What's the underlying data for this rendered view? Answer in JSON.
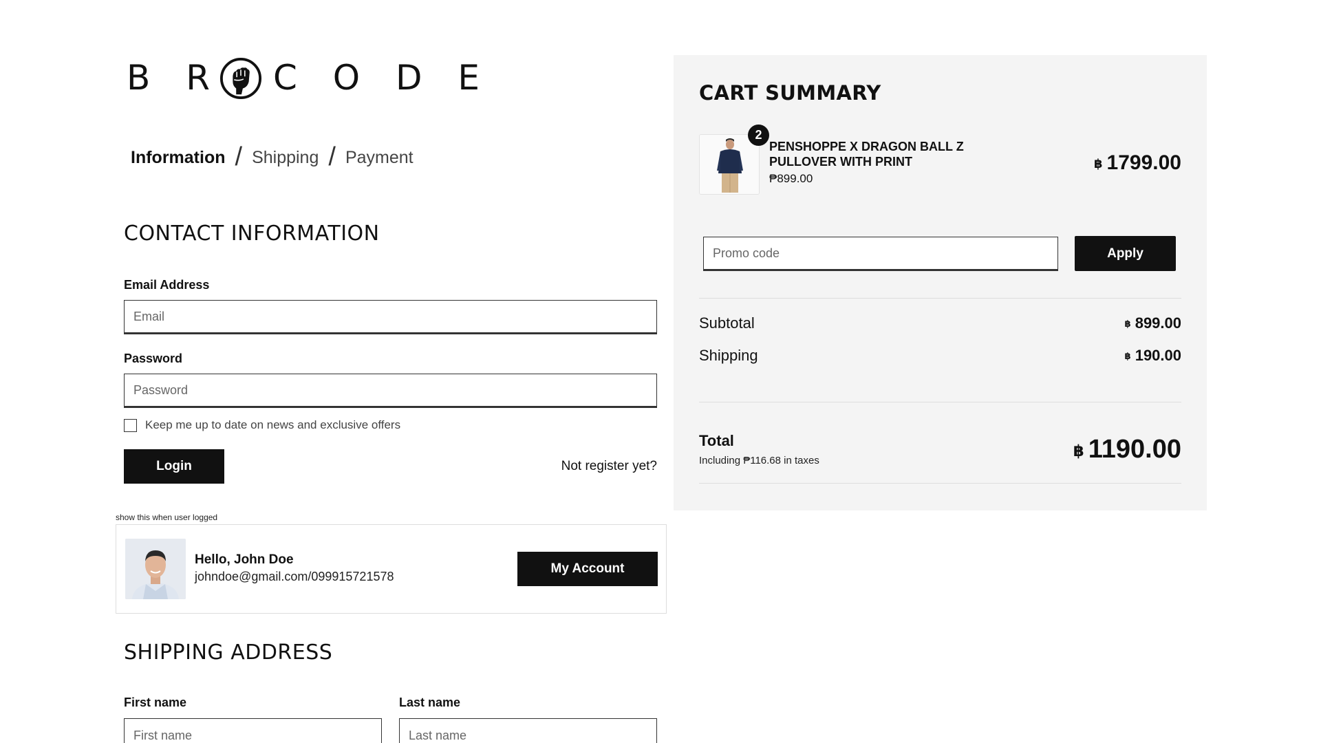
{
  "brand": {
    "prefix": "B R",
    "suffix": "C O D E"
  },
  "steps": [
    {
      "label": "Information",
      "active": true
    },
    {
      "label": "Shipping",
      "active": false
    },
    {
      "label": "Payment",
      "active": false
    }
  ],
  "contact": {
    "title": "CONTACT INFORMATION",
    "email_label": "Email Address",
    "email_placeholder": "Email",
    "password_label": "Password",
    "password_placeholder": "Password",
    "newsletter_label": "Keep me up to date on news and exclusive offers",
    "login_label": "Login",
    "not_register": "Not register yet?"
  },
  "logged_user": {
    "note": "show this when user logged",
    "hello": "Hello, John Doe",
    "contact": "johndoe@gmail.com/099915721578",
    "account_label": "My Account"
  },
  "shipping": {
    "title": "SHIPPING ADDRESS",
    "first_label": "First name",
    "first_placeholder": "First name",
    "last_label": "Last name",
    "last_placeholder": "Last name"
  },
  "cart": {
    "title": "CART SUMMARY",
    "item": {
      "qty": "2",
      "name": "PENSHOPPE X DRAGON BALL Z PULLOVER WITH PRINT",
      "unit_price": "₱899.00",
      "total": "1799.00"
    },
    "promo_placeholder": "Promo code",
    "apply_label": "Apply",
    "subtotal_label": "Subtotal",
    "subtotal_value": "899.00",
    "shipping_label": "Shipping",
    "shipping_value": "190.00",
    "total_label": "Total",
    "tax_note": "Including ₱116.68 in taxes",
    "total_value": "1190.00",
    "currency_symbol": "฿"
  }
}
